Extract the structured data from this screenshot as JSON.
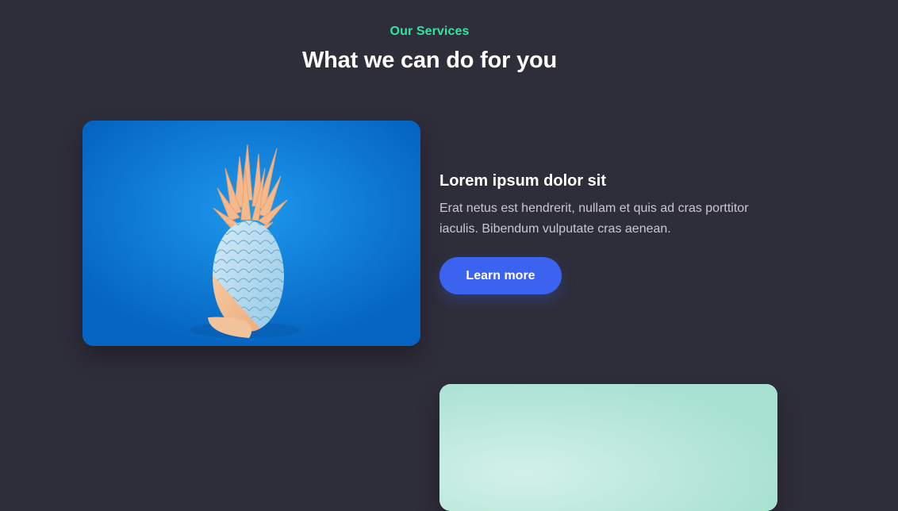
{
  "section": {
    "eyebrow": "Our Services",
    "title": "What we can do for you"
  },
  "features": [
    {
      "image": "pineapple-photo",
      "title": "Lorem ipsum dolor sit",
      "text": "Erat netus est hendrerit, nullam et quis ad cras porttitor iaculis. Bibendum vulputate cras aenean.",
      "button_label": "Learn more"
    },
    {
      "image": "mint-photo"
    }
  ],
  "colors": {
    "background": "#2e2d3a",
    "accent": "#2ee59d",
    "button": "#3b63f0"
  }
}
